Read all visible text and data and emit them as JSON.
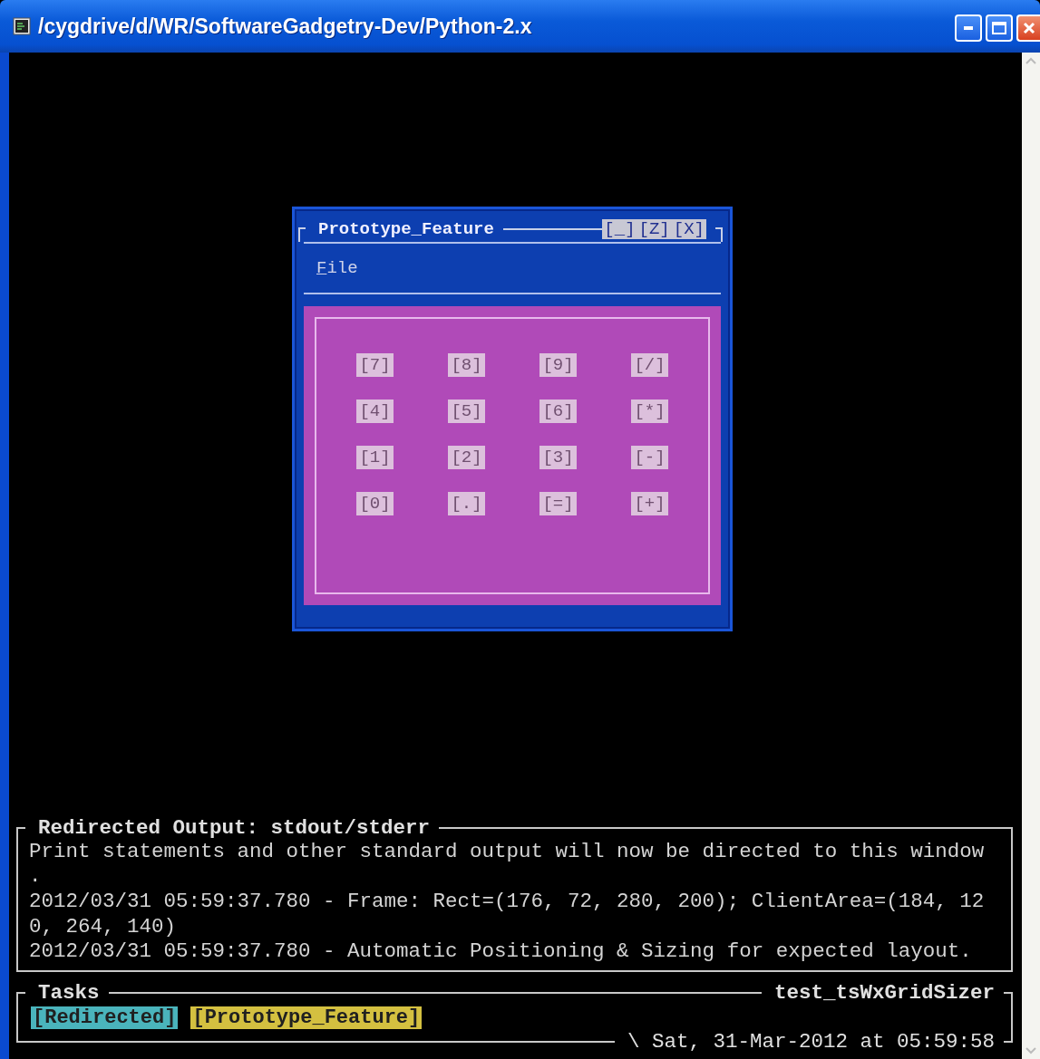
{
  "window": {
    "title": "/cygdrive/d/WR/SoftwareGadgetry-Dev/Python-2.x"
  },
  "dialog": {
    "title": "Prototype_Feature",
    "controls": [
      "[_]",
      "[Z]",
      "[X]"
    ],
    "menu": [
      {
        "label": "File"
      }
    ],
    "keys": [
      "[7]",
      "[8]",
      "[9]",
      "[/]",
      "[4]",
      "[5]",
      "[6]",
      "[*]",
      "[1]",
      "[2]",
      "[3]",
      "[-]",
      "[0]",
      "[.]",
      "[=]",
      "[+]"
    ]
  },
  "output": {
    "title": "Redirected Output: stdout/stderr",
    "lines": [
      "Print statements and other standard output will now be directed to this window",
      ".",
      "2012/03/31 05:59:37.780 - Frame: Rect=(176, 72, 280, 200); ClientArea=(184, 12",
      "0, 264, 140)",
      "2012/03/31 05:59:37.780 - Automatic Positioning & Sizing for expected layout."
    ]
  },
  "tasks": {
    "title": "Tasks",
    "app": "test_tsWxGridSizer",
    "timestamp": "\\ Sat, 31-Mar-2012 at 05:59:58",
    "items": [
      {
        "label": "[Redirected]",
        "color": "#4ab4bc"
      },
      {
        "label": "[Prototype_Feature]",
        "color": "#d4c040"
      }
    ]
  }
}
